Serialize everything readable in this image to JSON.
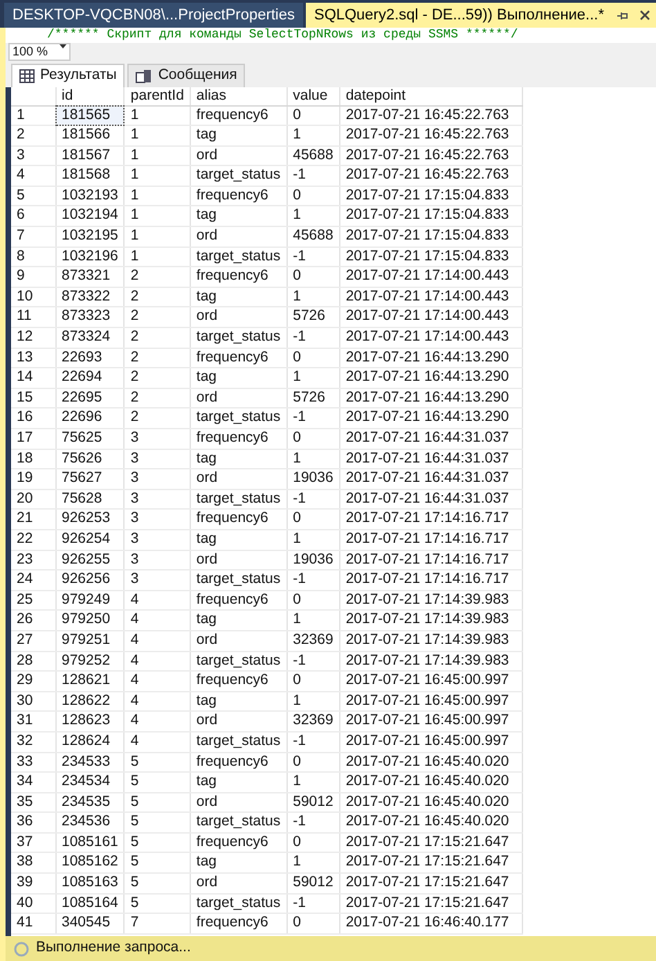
{
  "doc_tabs": [
    {
      "label": "DESKTOP-VQCBN08\\...ProjectProperties",
      "selected": false
    },
    {
      "label": "SQLQuery2.sql - DE...59)) Выполнение...*",
      "selected": true
    }
  ],
  "code_line": "/****** Скрипт для команды SelectTopNRows из среды SSMS  ******/",
  "zoom": "100 %",
  "result_tabs": [
    {
      "label": "Результаты",
      "kind": "grid",
      "selected": true
    },
    {
      "label": "Сообщения",
      "kind": "messages",
      "selected": false
    }
  ],
  "table": {
    "columns": [
      "id",
      "parentId",
      "alias",
      "value",
      "datepoint"
    ],
    "rows": [
      {
        "n": "1",
        "cells": [
          "181565",
          "1",
          "frequency6",
          "0",
          "2017-07-21 16:45:22.763"
        ],
        "focused": true
      },
      {
        "n": "2",
        "cells": [
          "181566",
          "1",
          "tag",
          "1",
          "2017-07-21 16:45:22.763"
        ],
        "focused": false
      },
      {
        "n": "3",
        "cells": [
          "181567",
          "1",
          "ord",
          "45688",
          "2017-07-21 16:45:22.763"
        ],
        "focused": false
      },
      {
        "n": "4",
        "cells": [
          "181568",
          "1",
          "target_status",
          "-1",
          "2017-07-21 16:45:22.763"
        ],
        "focused": false
      },
      {
        "n": "5",
        "cells": [
          "1032193",
          "1",
          "frequency6",
          "0",
          "2017-07-21 17:15:04.833"
        ],
        "focused": false
      },
      {
        "n": "6",
        "cells": [
          "1032194",
          "1",
          "tag",
          "1",
          "2017-07-21 17:15:04.833"
        ],
        "focused": false
      },
      {
        "n": "7",
        "cells": [
          "1032195",
          "1",
          "ord",
          "45688",
          "2017-07-21 17:15:04.833"
        ],
        "focused": false
      },
      {
        "n": "8",
        "cells": [
          "1032196",
          "1",
          "target_status",
          "-1",
          "2017-07-21 17:15:04.833"
        ],
        "focused": false
      },
      {
        "n": "9",
        "cells": [
          "873321",
          "2",
          "frequency6",
          "0",
          "2017-07-21 17:14:00.443"
        ],
        "focused": false
      },
      {
        "n": "10",
        "cells": [
          "873322",
          "2",
          "tag",
          "1",
          "2017-07-21 17:14:00.443"
        ],
        "focused": false
      },
      {
        "n": "11",
        "cells": [
          "873323",
          "2",
          "ord",
          "5726",
          "2017-07-21 17:14:00.443"
        ],
        "focused": false
      },
      {
        "n": "12",
        "cells": [
          "873324",
          "2",
          "target_status",
          "-1",
          "2017-07-21 17:14:00.443"
        ],
        "focused": false
      },
      {
        "n": "13",
        "cells": [
          "22693",
          "2",
          "frequency6",
          "0",
          "2017-07-21 16:44:13.290"
        ],
        "focused": false
      },
      {
        "n": "14",
        "cells": [
          "22694",
          "2",
          "tag",
          "1",
          "2017-07-21 16:44:13.290"
        ],
        "focused": false
      },
      {
        "n": "15",
        "cells": [
          "22695",
          "2",
          "ord",
          "5726",
          "2017-07-21 16:44:13.290"
        ],
        "focused": false
      },
      {
        "n": "16",
        "cells": [
          "22696",
          "2",
          "target_status",
          "-1",
          "2017-07-21 16:44:13.290"
        ],
        "focused": false
      },
      {
        "n": "17",
        "cells": [
          "75625",
          "3",
          "frequency6",
          "0",
          "2017-07-21 16:44:31.037"
        ],
        "focused": false
      },
      {
        "n": "18",
        "cells": [
          "75626",
          "3",
          "tag",
          "1",
          "2017-07-21 16:44:31.037"
        ],
        "focused": false
      },
      {
        "n": "19",
        "cells": [
          "75627",
          "3",
          "ord",
          "19036",
          "2017-07-21 16:44:31.037"
        ],
        "focused": false
      },
      {
        "n": "20",
        "cells": [
          "75628",
          "3",
          "target_status",
          "-1",
          "2017-07-21 16:44:31.037"
        ],
        "focused": false
      },
      {
        "n": "21",
        "cells": [
          "926253",
          "3",
          "frequency6",
          "0",
          "2017-07-21 17:14:16.717"
        ],
        "focused": false
      },
      {
        "n": "22",
        "cells": [
          "926254",
          "3",
          "tag",
          "1",
          "2017-07-21 17:14:16.717"
        ],
        "focused": false
      },
      {
        "n": "23",
        "cells": [
          "926255",
          "3",
          "ord",
          "19036",
          "2017-07-21 17:14:16.717"
        ],
        "focused": false
      },
      {
        "n": "24",
        "cells": [
          "926256",
          "3",
          "target_status",
          "-1",
          "2017-07-21 17:14:16.717"
        ],
        "focused": false
      },
      {
        "n": "25",
        "cells": [
          "979249",
          "4",
          "frequency6",
          "0",
          "2017-07-21 17:14:39.983"
        ],
        "focused": false
      },
      {
        "n": "26",
        "cells": [
          "979250",
          "4",
          "tag",
          "1",
          "2017-07-21 17:14:39.983"
        ],
        "focused": false
      },
      {
        "n": "27",
        "cells": [
          "979251",
          "4",
          "ord",
          "32369",
          "2017-07-21 17:14:39.983"
        ],
        "focused": false
      },
      {
        "n": "28",
        "cells": [
          "979252",
          "4",
          "target_status",
          "-1",
          "2017-07-21 17:14:39.983"
        ],
        "focused": false
      },
      {
        "n": "29",
        "cells": [
          "128621",
          "4",
          "frequency6",
          "0",
          "2017-07-21 16:45:00.997"
        ],
        "focused": false
      },
      {
        "n": "30",
        "cells": [
          "128622",
          "4",
          "tag",
          "1",
          "2017-07-21 16:45:00.997"
        ],
        "focused": false
      },
      {
        "n": "31",
        "cells": [
          "128623",
          "4",
          "ord",
          "32369",
          "2017-07-21 16:45:00.997"
        ],
        "focused": false
      },
      {
        "n": "32",
        "cells": [
          "128624",
          "4",
          "target_status",
          "-1",
          "2017-07-21 16:45:00.997"
        ],
        "focused": false
      },
      {
        "n": "33",
        "cells": [
          "234533",
          "5",
          "frequency6",
          "0",
          "2017-07-21 16:45:40.020"
        ],
        "focused": false
      },
      {
        "n": "34",
        "cells": [
          "234534",
          "5",
          "tag",
          "1",
          "2017-07-21 16:45:40.020"
        ],
        "focused": false
      },
      {
        "n": "35",
        "cells": [
          "234535",
          "5",
          "ord",
          "59012",
          "2017-07-21 16:45:40.020"
        ],
        "focused": false
      },
      {
        "n": "36",
        "cells": [
          "234536",
          "5",
          "target_status",
          "-1",
          "2017-07-21 16:45:40.020"
        ],
        "focused": false
      },
      {
        "n": "37",
        "cells": [
          "1085161",
          "5",
          "frequency6",
          "0",
          "2017-07-21 17:15:21.647"
        ],
        "focused": false
      },
      {
        "n": "38",
        "cells": [
          "1085162",
          "5",
          "tag",
          "1",
          "2017-07-21 17:15:21.647"
        ],
        "focused": false
      },
      {
        "n": "39",
        "cells": [
          "1085163",
          "5",
          "ord",
          "59012",
          "2017-07-21 17:15:21.647"
        ],
        "focused": false
      },
      {
        "n": "40",
        "cells": [
          "1085164",
          "5",
          "target_status",
          "-1",
          "2017-07-21 17:15:21.647"
        ],
        "focused": false
      },
      {
        "n": "41",
        "cells": [
          "340545",
          "7",
          "frequency6",
          "0",
          "2017-07-21 16:46:40.177"
        ],
        "focused": false
      }
    ]
  },
  "status": "Выполнение запроса..."
}
